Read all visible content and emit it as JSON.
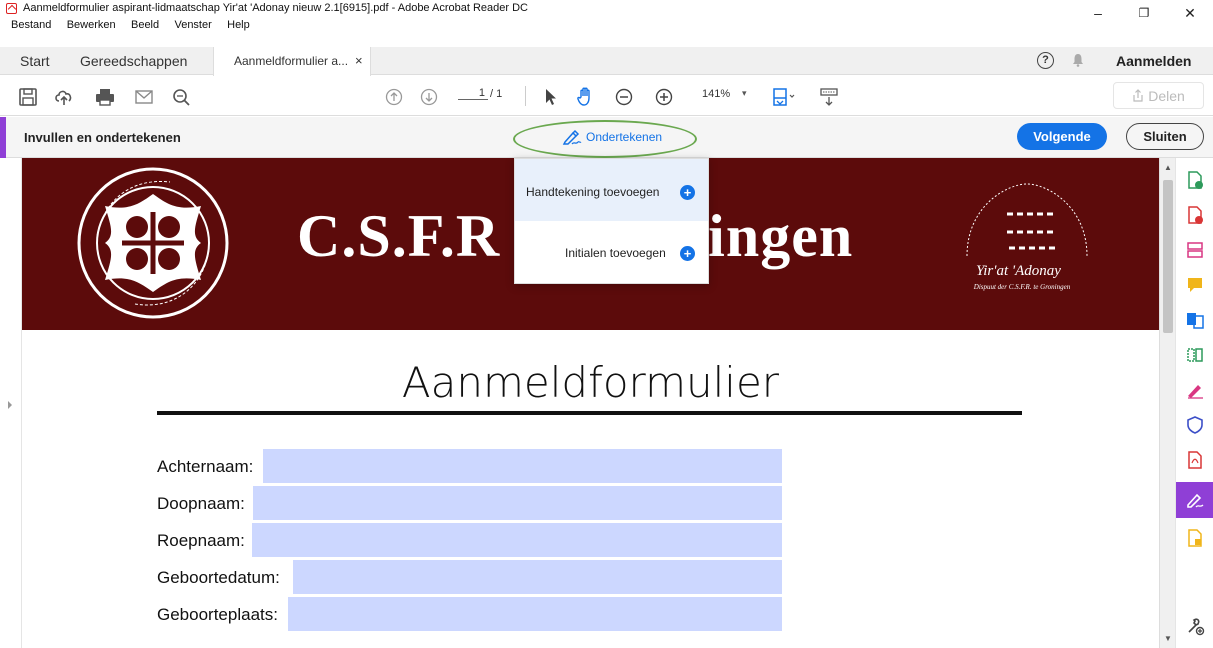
{
  "window": {
    "title": "Aanmeldformulier aspirant-lidmaatschap Yir'at 'Adonay nieuw 2.1[6915].pdf - Adobe Acrobat Reader DC",
    "minimize": "–",
    "restore": "❐",
    "close": "✕"
  },
  "menu": [
    "Bestand",
    "Bewerken",
    "Beeld",
    "Venster",
    "Help"
  ],
  "tabs": {
    "start": "Start",
    "tools": "Gereedschappen",
    "document": "Aanmeldformulier a...",
    "document_close": "×",
    "signin": "Aanmelden",
    "help": "?"
  },
  "toolbar": {
    "page_current": "1",
    "page_total": "/ 1",
    "zoom": "141%",
    "zoom_caret": "▾",
    "share": "Delen"
  },
  "fillsign": {
    "label": "Invullen en ondertekenen",
    "sign": "Ondertekenen",
    "next": "Volgende",
    "close": "Sluiten"
  },
  "sign_menu": {
    "add_signature": "Handtekening toevoegen",
    "add_initials": "Initialen toevoegen"
  },
  "document": {
    "banner_title": "C.S.F.R",
    "banner_title_tail": "ingen",
    "logo_name": "Yir'at 'Adonay",
    "logo_sub": "Dispuut der C.S.F.R. te Groningen",
    "form_title": "Aanmeldformulier",
    "fields": [
      {
        "label": "Achternaam:"
      },
      {
        "label": "Doopnaam:"
      },
      {
        "label": "Roepnaam:"
      },
      {
        "label": "Geboortedatum:"
      },
      {
        "label": "Geboorteplaats:"
      }
    ]
  },
  "colors": {
    "accent_blue": "#1473e6",
    "purple": "#8f3fd6",
    "banner_maroon": "#5c0b0b",
    "field_fill": "#ccd7ff",
    "highlight_oval": "#6aa84f"
  }
}
